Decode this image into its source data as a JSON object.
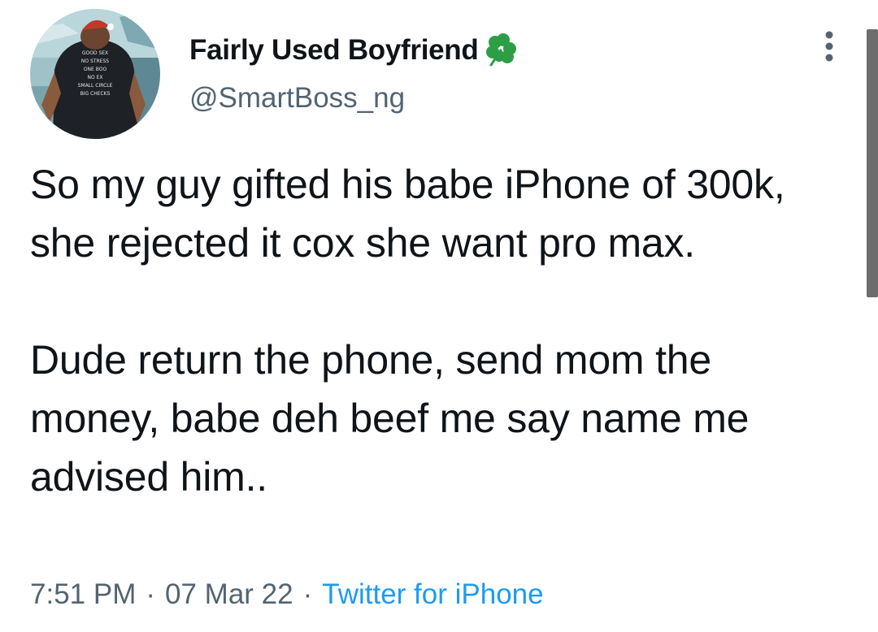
{
  "tweet": {
    "display_name": "Fairly Used Boyfriend",
    "badge_icon": "four-leaf-clover-icon",
    "handle": "@SmartBoss_ng",
    "text": [
      "So my guy gifted his babe iPhone of 300k, she rejected it cox she want pro max.",
      "Dude return the phone, send mom the money, babe deh beef me say name me advised him.."
    ],
    "time": "7:51 PM",
    "separator": "·",
    "date": "07 Mar 22",
    "source": "Twitter for iPhone"
  },
  "avatar": {
    "shirt_lines": [
      "GOOD SEX",
      "NO STRESS",
      "ONE BOO",
      "NO EX",
      "SMALL CIRCLE",
      "BIG CHECKS"
    ]
  },
  "colors": {
    "text": "#0f1419",
    "secondary": "#536471",
    "link": "#1d9bf0",
    "clover": "#2e9e46"
  }
}
